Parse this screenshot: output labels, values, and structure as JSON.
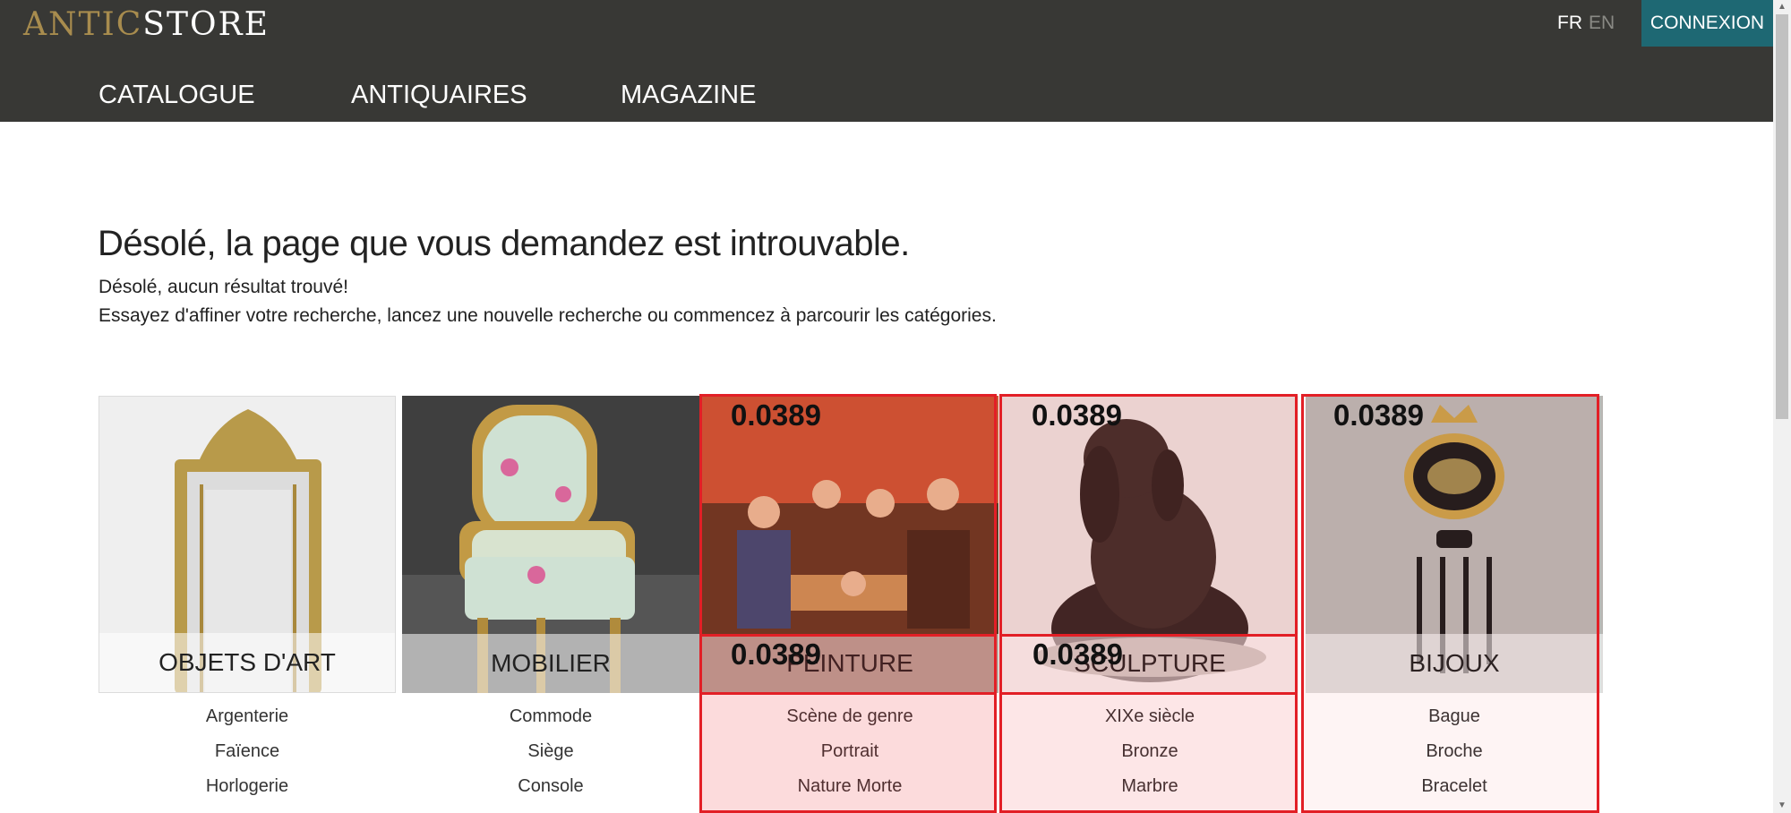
{
  "header": {
    "logo_part1": "ANTIC",
    "logo_part2": "STORE",
    "lang_fr": "FR",
    "lang_en": "EN",
    "login_label": "CONNEXION",
    "nav": [
      "CATALOGUE",
      "ANTIQUAIRES",
      "MAGAZINE"
    ]
  },
  "message": {
    "title": "Désolé, la page que vous demandez est introuvable.",
    "line1": "Désolé, aucun résultat trouvé!",
    "line2": "Essayez d'affiner votre recherche, lancez une nouvelle recherche ou commencez à parcourir les catégories."
  },
  "categories": [
    {
      "label": "OBJETS D'ART",
      "items": [
        "Argenterie",
        "Faïence",
        "Horlogerie"
      ]
    },
    {
      "label": "MOBILIER",
      "items": [
        "Commode",
        "Siège",
        "Console"
      ]
    },
    {
      "label": "PEINTURE",
      "items": [
        "Scène de genre",
        "Portrait",
        "Nature Morte"
      ]
    },
    {
      "label": "SCULPTURE",
      "items": [
        "XIXe siècle",
        "Bronze",
        "Marbre"
      ]
    },
    {
      "label": "BIJOUX",
      "items": [
        "Bague",
        "Broche",
        "Bracelet"
      ]
    }
  ],
  "overlay_scores": [
    "0.0389",
    "0.0389",
    "0.0389",
    "0.0389",
    "0.0389"
  ],
  "colors": {
    "header_bg": "#383835",
    "logo_gold": "#a88c4e",
    "login_bg": "#1e6873",
    "overlay_red": "#e21f26"
  }
}
